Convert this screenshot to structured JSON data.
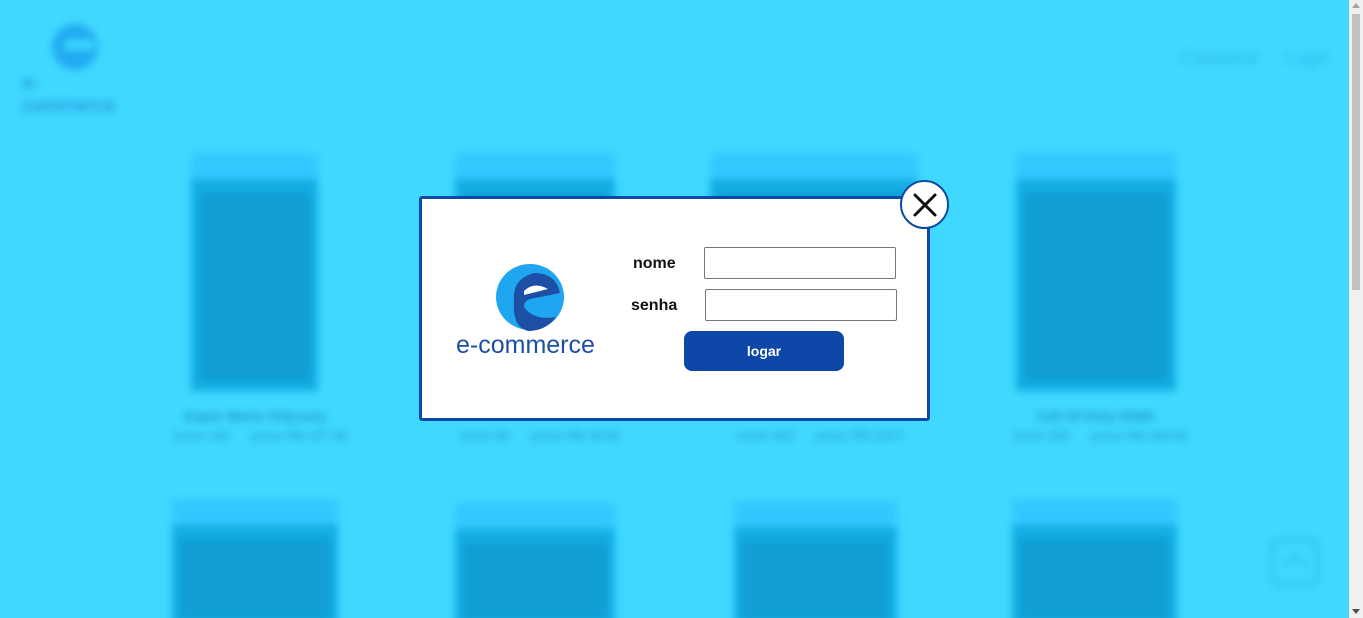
{
  "header": {
    "logo_text": "e-commerce",
    "nav": [
      {
        "label": "Cadastrar"
      },
      {
        "label": "Login"
      }
    ]
  },
  "products_row1": [
    {
      "title": "Super Mario Odyssey",
      "score_label": "score",
      "score": "100",
      "price_label": "preço",
      "price": "R$ 197.88"
    },
    {
      "title": "",
      "score_label": "score",
      "score": "80",
      "price_label": "preço",
      "price": "R$ 49.99"
    },
    {
      "title": "",
      "score_label": "score",
      "score": "200",
      "price_label": "preço",
      "price": "R$ 119.5"
    },
    {
      "title": "Call Of Duty WWII",
      "score_label": "score",
      "score": "205",
      "price_label": "preço",
      "price": "R$ 249.99"
    }
  ],
  "modal": {
    "logo_text": "e-commerce",
    "name_label": "nome",
    "name_value": "",
    "password_label": "senha",
    "password_value": "",
    "submit_label": "logar"
  },
  "colors": {
    "background": "#40d8ff",
    "primary": "#0d47a8",
    "logo_light": "#1ea6f0"
  },
  "icons": [
    "close-icon",
    "scroll-top-icon"
  ]
}
